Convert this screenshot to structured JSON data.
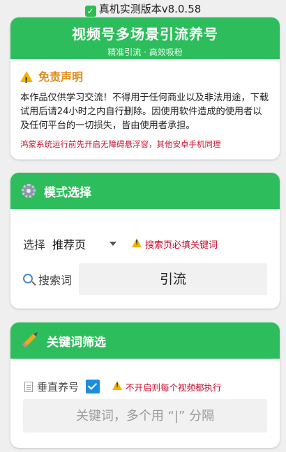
{
  "version": "真机实测版本v8.0.58",
  "header": {
    "title": "视频号多场景引流养号",
    "subtitle": "精准引流 · 高效吸粉"
  },
  "disclaimer": {
    "title": "免责声明",
    "body": "本作品仅供学习交流！不得用于任何商业以及非法用途，下载试用后请24小时之内自行删除。因使用软件造成的使用者以及任何平台的一切损失，皆由使用者承担。",
    "note": "鸿蒙系统运行前先开启无障碍悬浮窗，其他安卓手机同理"
  },
  "mode": {
    "title": "模式选择",
    "select_label": "选择",
    "select_value": "推荐页",
    "warning": "搜索页必填关键词",
    "search_label": "搜索词",
    "search_value": "引流"
  },
  "keywords": {
    "title": "关键词筛选",
    "vertical_label": "垂直养号",
    "vertical_checked": true,
    "warning": "不开启则每个视频都执行",
    "input_placeholder": "关键词，多个用 “|” 分隔"
  },
  "colors": {
    "accent": "#2ebd5c",
    "warning_text": "#c8102e",
    "disclaimer_title": "#e08a18",
    "checkbox": "#1a8de0"
  }
}
